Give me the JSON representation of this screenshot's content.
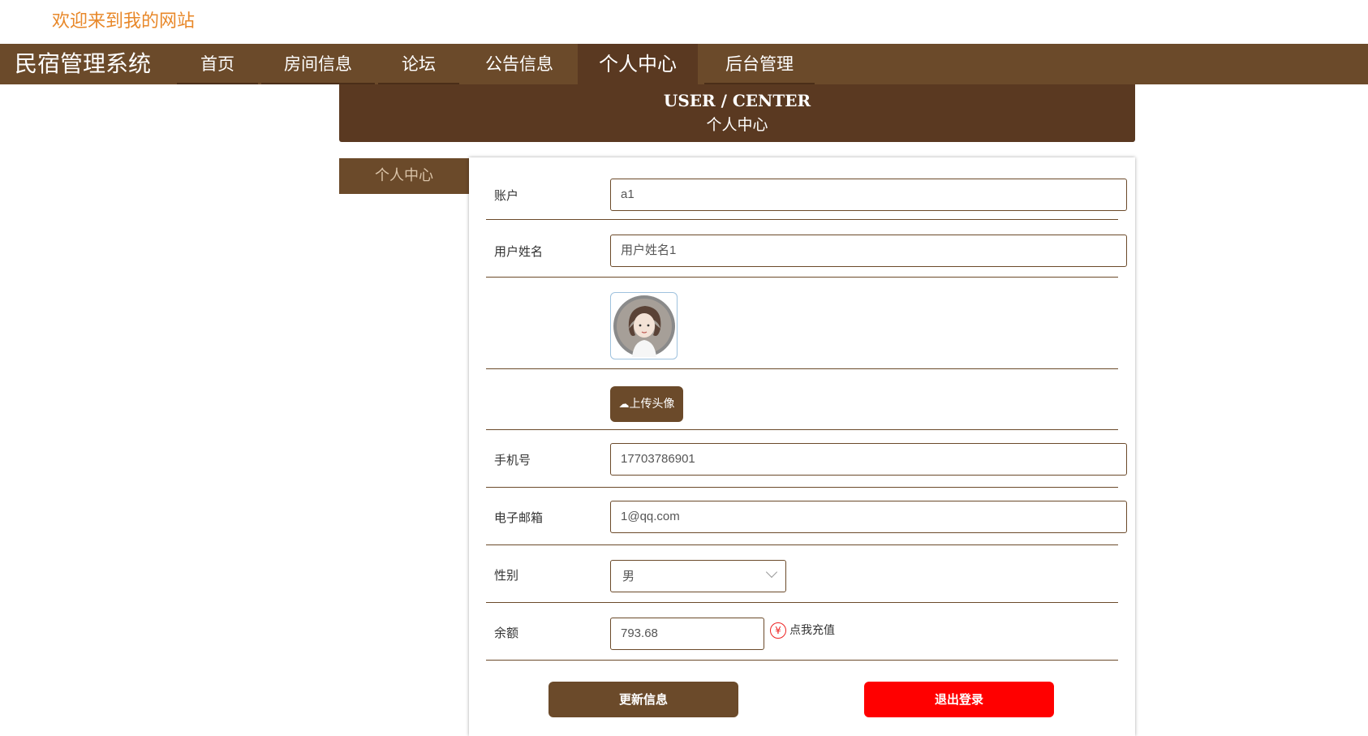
{
  "header": {
    "welcome": "欢迎来到我的网站"
  },
  "nav": {
    "brand": "民宿管理系统",
    "items": [
      {
        "label": "首页"
      },
      {
        "label": "房间信息"
      },
      {
        "label": "论坛"
      },
      {
        "label": "公告信息"
      },
      {
        "label": "个人中心"
      },
      {
        "label": "后台管理"
      }
    ],
    "active": "个人中心"
  },
  "banner": {
    "en": "USER / CENTER",
    "cn": "个人中心"
  },
  "sidebar": {
    "tab": "个人中心"
  },
  "form": {
    "account": {
      "label": "账户",
      "value": "a1"
    },
    "name": {
      "label": "用户姓名",
      "value": "用户姓名1"
    },
    "avatar": {
      "upload_label": "上传头像"
    },
    "phone": {
      "label": "手机号",
      "value": "17703786901"
    },
    "email": {
      "label": "电子邮箱",
      "value": "1@qq.com"
    },
    "gender": {
      "label": "性别",
      "value": "男"
    },
    "balance": {
      "label": "余额",
      "value": "793.68",
      "recharge": "点我充值",
      "yuan_symbol": "¥"
    }
  },
  "actions": {
    "update": "更新信息",
    "logout": "退出登录"
  },
  "colors": {
    "brown": "#6b4a2a",
    "dark_brown": "#5a3921",
    "welcome": "#e8882a",
    "logout": "#ff0000"
  }
}
